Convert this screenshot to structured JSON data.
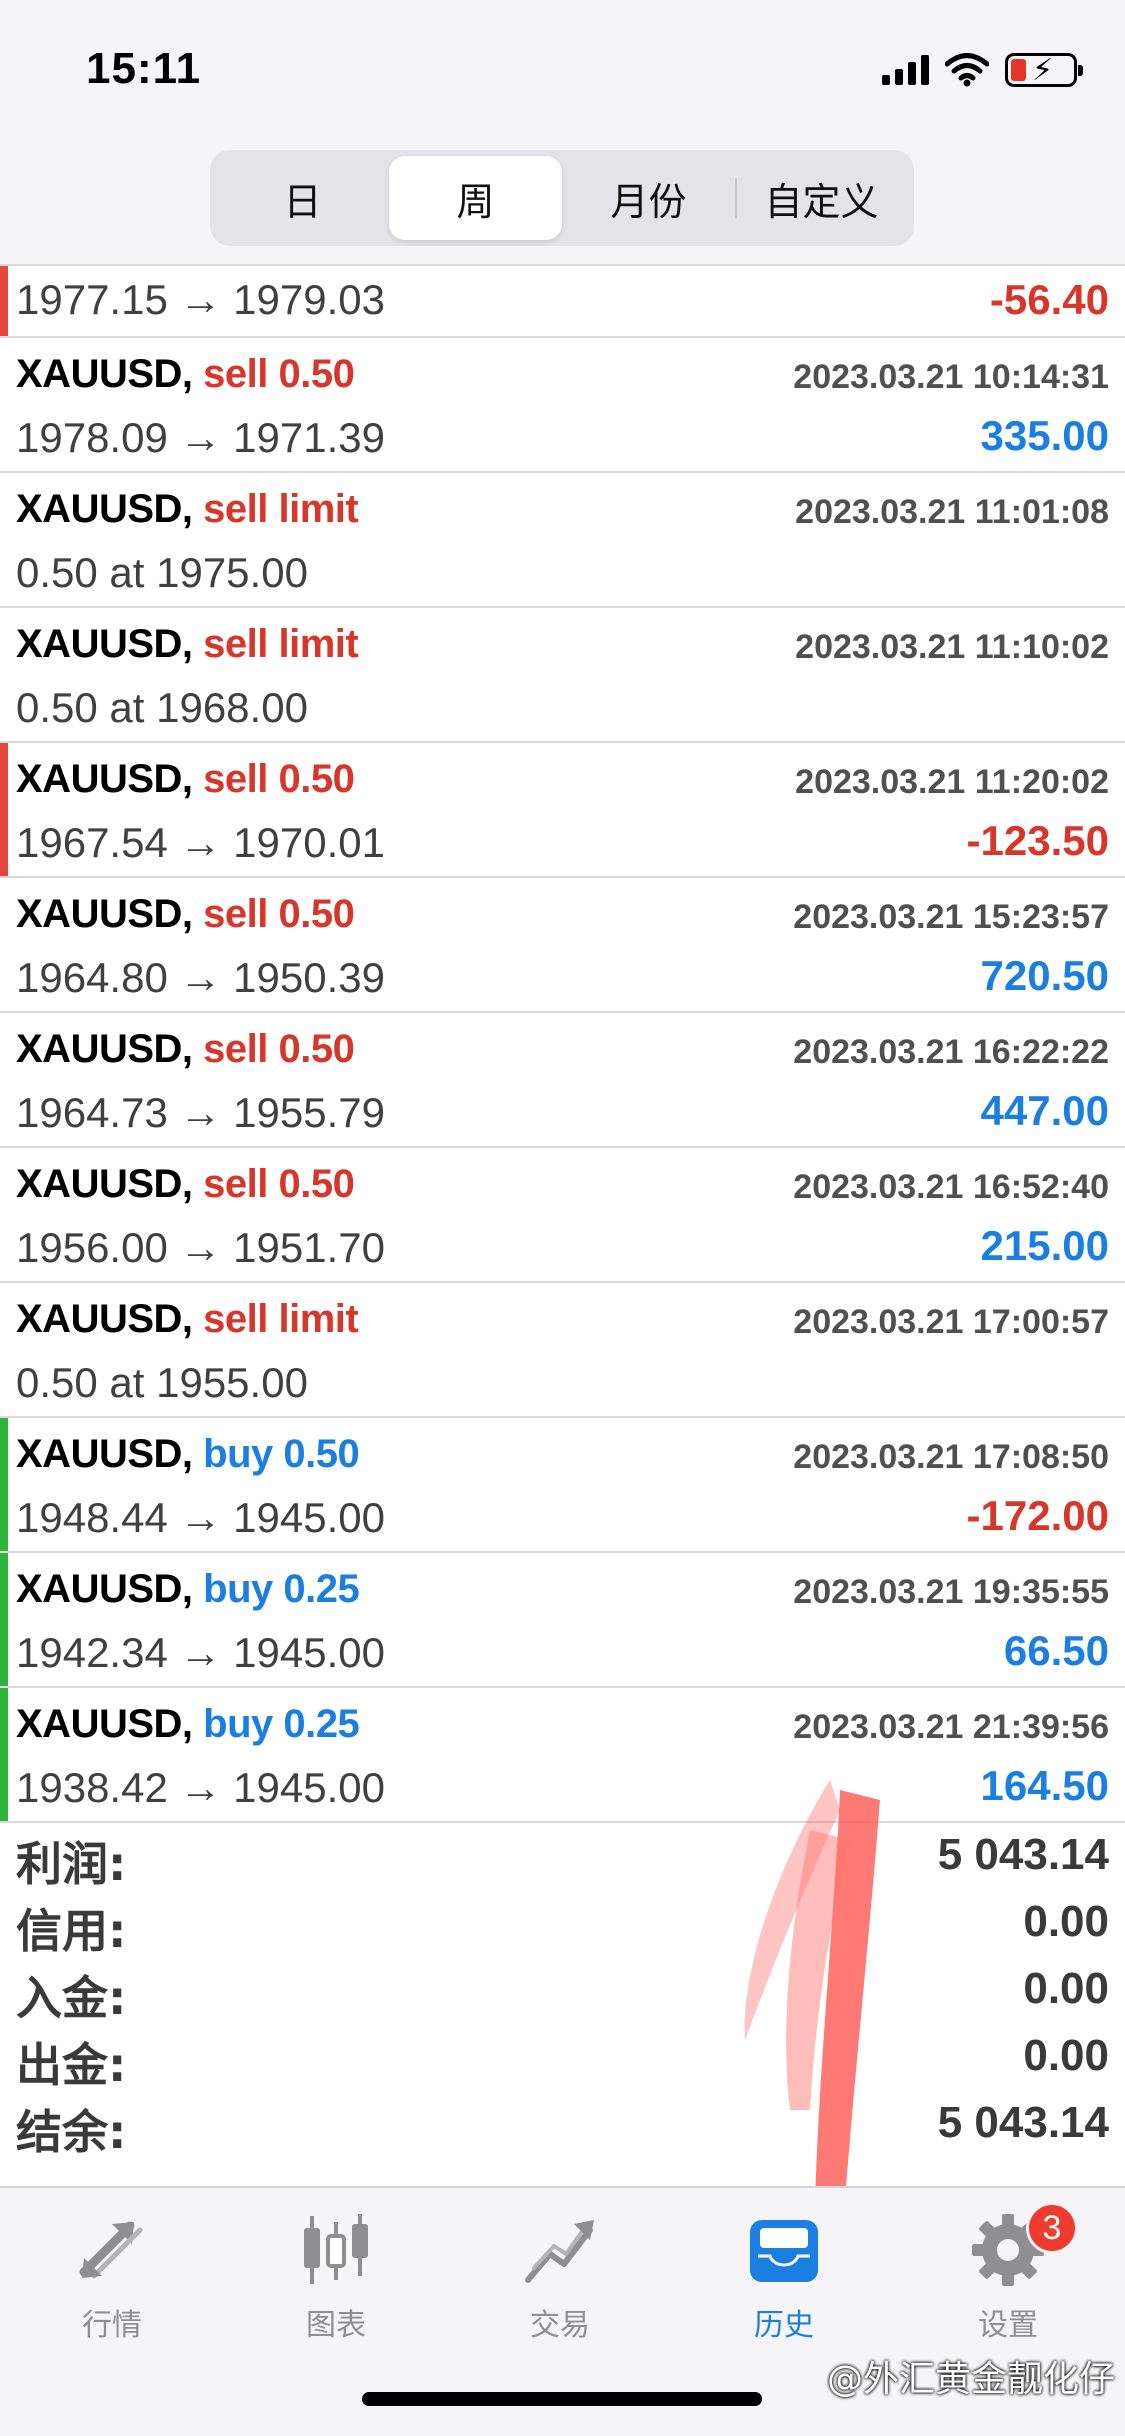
{
  "status": {
    "time": "15:11"
  },
  "segments": [
    "日",
    "周",
    "月份",
    "自定义"
  ],
  "first_row": {
    "prices": "1977.15 → 1979.03",
    "profit": "-56.40"
  },
  "rows": [
    {
      "symbol": "XAUUSD,",
      "side": "sell 0.50",
      "time": "2023.03.21 10:14:31",
      "prices": "1978.09 → 1971.39",
      "profit": "335.00"
    },
    {
      "symbol": "XAUUSD,",
      "side": "sell limit",
      "time": "2023.03.21 11:01:08",
      "prices": "0.50 at 1975.00",
      "profit": ""
    },
    {
      "symbol": "XAUUSD,",
      "side": "sell limit",
      "time": "2023.03.21 11:10:02",
      "prices": "0.50 at 1968.00",
      "profit": ""
    },
    {
      "symbol": "XAUUSD,",
      "side": "sell 0.50",
      "time": "2023.03.21 11:20:02",
      "prices": "1967.54 → 1970.01",
      "profit": "-123.50"
    },
    {
      "symbol": "XAUUSD,",
      "side": "sell 0.50",
      "time": "2023.03.21 15:23:57",
      "prices": "1964.80 → 1950.39",
      "profit": "720.50"
    },
    {
      "symbol": "XAUUSD,",
      "side": "sell 0.50",
      "time": "2023.03.21 16:22:22",
      "prices": "1964.73 → 1955.79",
      "profit": "447.00"
    },
    {
      "symbol": "XAUUSD,",
      "side": "sell 0.50",
      "time": "2023.03.21 16:52:40",
      "prices": "1956.00 → 1951.70",
      "profit": "215.00"
    },
    {
      "symbol": "XAUUSD,",
      "side": "sell limit",
      "time": "2023.03.21 17:00:57",
      "prices": "0.50 at 1955.00",
      "profit": ""
    },
    {
      "symbol": "XAUUSD,",
      "side": "buy 0.50",
      "time": "2023.03.21 17:08:50",
      "prices": "1948.44 → 1945.00",
      "profit": "-172.00"
    },
    {
      "symbol": "XAUUSD,",
      "side": "buy 0.25",
      "time": "2023.03.21 19:35:55",
      "prices": "1942.34 → 1945.00",
      "profit": "66.50"
    },
    {
      "symbol": "XAUUSD,",
      "side": "buy 0.25",
      "time": "2023.03.21 21:39:56",
      "prices": "1938.42 → 1945.00",
      "profit": "164.50"
    }
  ],
  "summary": [
    {
      "label": "利润:",
      "value": "5 043.14"
    },
    {
      "label": "信用:",
      "value": "0.00"
    },
    {
      "label": "入金:",
      "value": "0.00"
    },
    {
      "label": "出金:",
      "value": "0.00"
    },
    {
      "label": "结余:",
      "value": "5 043.14"
    }
  ],
  "tabs": [
    {
      "label": "行情",
      "icon": "quotes-arrows-icon"
    },
    {
      "label": "图表",
      "icon": "candlestick-chart-icon"
    },
    {
      "label": "交易",
      "icon": "trade-trend-icon"
    },
    {
      "label": "历史",
      "icon": "history-inbox-icon"
    },
    {
      "label": "设置",
      "icon": "gear-icon"
    }
  ],
  "settings_badge": "3",
  "watermark": "@外汇黄金靓化仔",
  "colors": {
    "sell": "#d7362b",
    "buy": "#1a7fe0",
    "loss": "#d7362b",
    "gain": "#1a7fe0",
    "active_tab": "#1a7fe0"
  }
}
